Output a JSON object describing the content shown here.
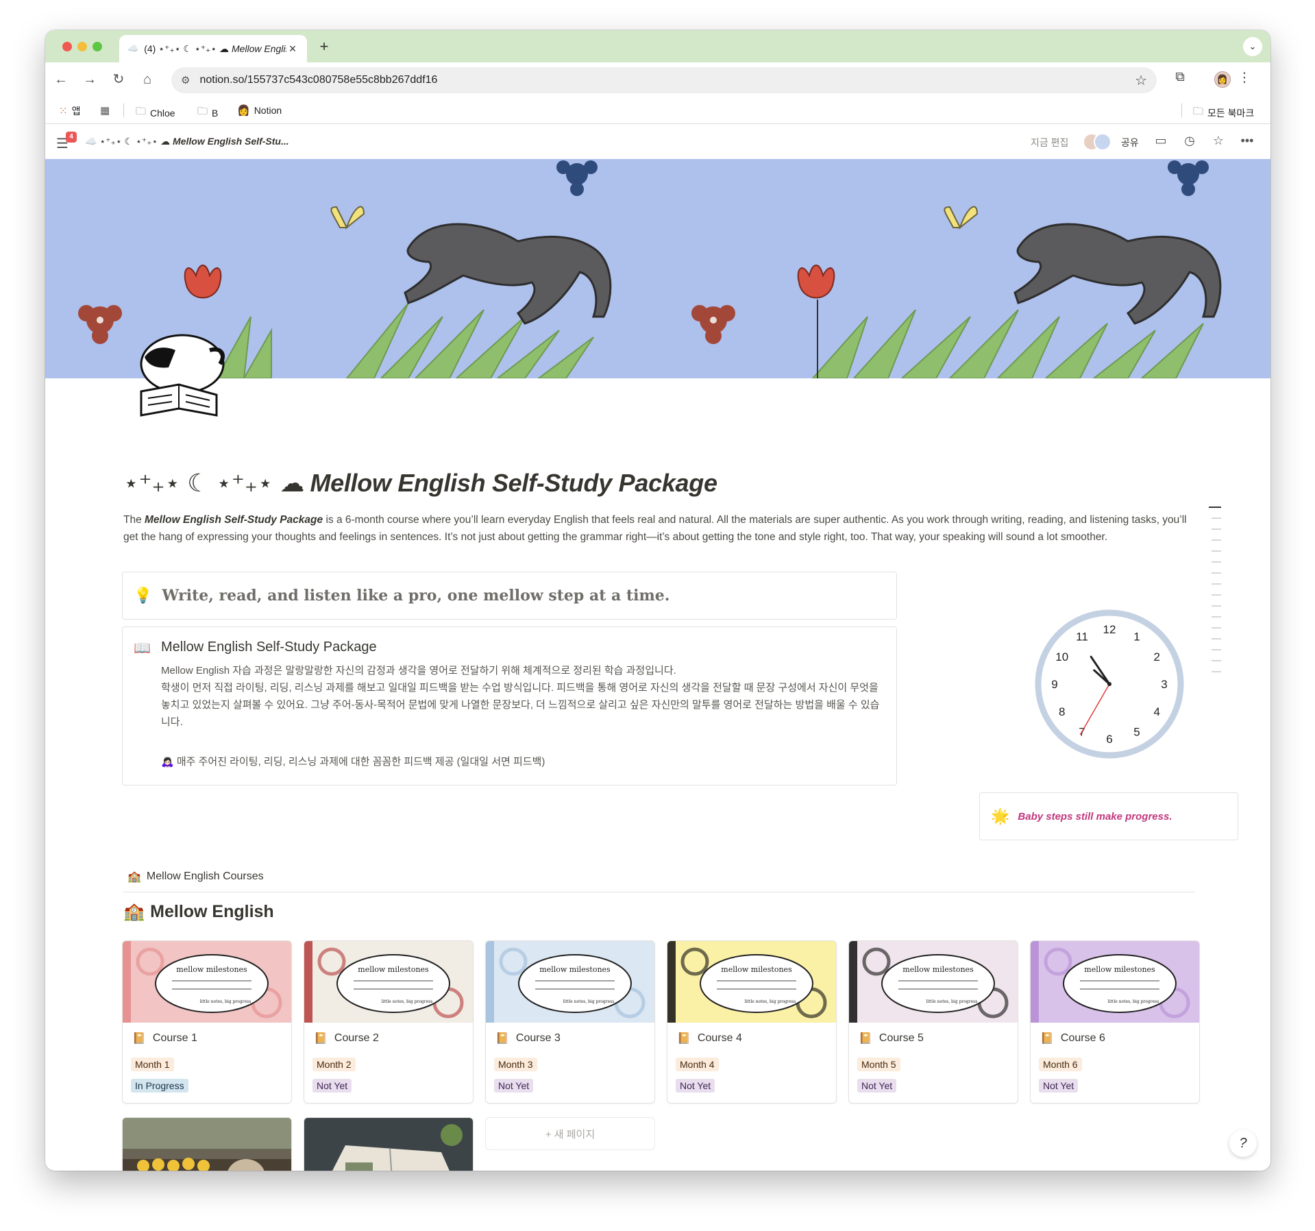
{
  "browser": {
    "tab": {
      "favicon": "☁️",
      "count": "(4)",
      "title_prefix": "⋆⁺₊⋆ ☾ ⋆⁺₊⋆ ☁",
      "title": "Mellow Englis"
    },
    "new_tab_icon": "+",
    "url": "notion.so/155737c543c080758e55c8bb267ddf16",
    "bookmarks": [
      {
        "icon": "apps-icon",
        "label": "앱"
      },
      {
        "icon": "grid-icon",
        "label": ""
      },
      {
        "icon": "folder-icon",
        "label": "Chloe"
      },
      {
        "icon": "folder-icon",
        "label": "B"
      },
      {
        "icon": "notion-icon",
        "label": "Notion"
      }
    ],
    "all_bookmarks": "모든 북마크"
  },
  "notion": {
    "notification_count": "4",
    "breadcrumb_prefix": "☁️ ⋆⁺₊⋆ ☾ ⋆⁺₊⋆ ☁",
    "breadcrumb": "Mellow English Self-Stu...",
    "editing_label": "지금 편집",
    "share_label": "공유"
  },
  "page": {
    "title_deco": "⋆⁺₊⋆ ☾ ⋆⁺₊⋆ ☁",
    "title": "Mellow English Self-Study Package",
    "intro_lead": "The ",
    "intro_em": "Mellow English Self-Study Package",
    "intro_rest": " is a 6-month course where you’ll learn everyday English that feels real and natural. All the materials are super authentic.  As you work through writing, reading, and listening tasks, you’ll get the hang of expressing your thoughts and feelings in sentences. It’s not just about getting the grammar right—it’s about getting the tone and style right, too. That way, your speaking will sound a lot smoother.",
    "callout_tagline": {
      "icon": "💡",
      "text": "Write, read, and listen like a pro, one mellow step at a time."
    },
    "callout_package": {
      "icon": "📖",
      "title": "Mellow English Self-Study Package",
      "line1": "Mellow English 자습 과정은 말랑말랑한 자신의 감정과 생각을 영어로 전달하기 위해 체계적으로 정리된 학습 과정입니다.",
      "line2": "학생이 먼저 직접 라이팅, 리딩, 리스닝 과제를 해보고 일대일 피드백을 받는 수업 방식입니다. 피드백을 통해 영어로 자신의 생각을 전달할 때 문장 구성에서 자신이 무엇을 놓치고 있었는지 살펴볼 수 있어요. 그냥 주어-동사-목적어 문법에 맞게 나열한 문장보다, 더 느낌적으로 살리고 싶은 자신만의 말투를 영어로 전달하는 방법을 배울 수 있습니다.",
      "bullet": "🙇🏻‍♀️ 매주 주어진 라이팅, 리딩, 리스닝 과제에 대한 꼼꼼한 피드백 제공 (일대일 서면 피드백)"
    },
    "callout_progress": {
      "icon": "🌟",
      "text": "Baby steps still make progress."
    },
    "clock": {
      "numbers": [
        "12",
        "1",
        "2",
        "3",
        "4",
        "5",
        "6",
        "7",
        "8",
        "9",
        "10",
        "11"
      ],
      "time": "10:52:35"
    },
    "linked_db_label": "Mellow English Courses",
    "linked_db_icon": "🏫",
    "database": {
      "icon": "🏫",
      "title": "Mellow English",
      "cover_text": "mellow milestones",
      "cover_subtext": "little notes, big progress",
      "courses": [
        {
          "title": "Course 1",
          "month": "Month 1",
          "status": "In Progress",
          "color": "#f2c4c4",
          "accent": "#e58a8a"
        },
        {
          "title": "Course 2",
          "month": "Month 2",
          "status": "Not Yet",
          "color": "#f1ece4",
          "accent": "#b53a3a"
        },
        {
          "title": "Course 3",
          "month": "Month 3",
          "status": "Not Yet",
          "color": "#dbe7f3",
          "accent": "#9fbddb"
        },
        {
          "title": "Course 4",
          "month": "Month 4",
          "status": "Not Yet",
          "color": "#fbf1a6",
          "accent": "#111111"
        },
        {
          "title": "Course 5",
          "month": "Month 5",
          "status": "Not Yet",
          "color": "#f0e5ec",
          "accent": "#111111"
        },
        {
          "title": "Course 6",
          "month": "Month 6",
          "status": "Not Yet",
          "color": "#d9c2ea",
          "accent": "#b48cd3"
        }
      ],
      "new_page_label": "+ 새 페이지"
    }
  },
  "colors": {
    "tabstrip": "#d3e8c8",
    "cover_sky": "#aec0ec",
    "accent_pink": "#c2377f"
  }
}
